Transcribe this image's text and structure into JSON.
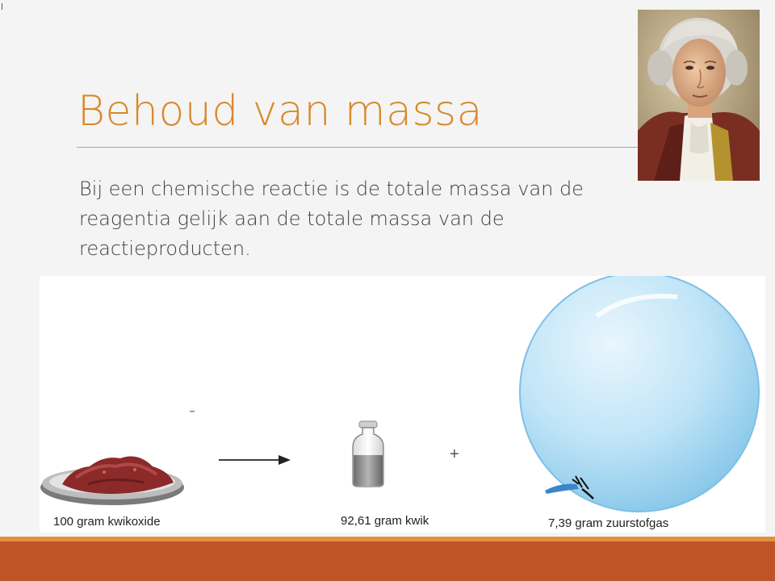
{
  "slide": {
    "title": "Behoud van massa",
    "body": "Bij een chemische reactie is de totale massa van de reagentia gelijk aan de totale massa van de reactieproducten."
  },
  "portrait": {
    "description_icon": "portrait-lavoisier"
  },
  "illustration": {
    "captions": {
      "reactant": "100 gram kwikoxide",
      "product_1": "92,61 gram kwik",
      "product_2": "7,39 gram zuurstofgas"
    },
    "plus_sign": "+",
    "icons": [
      "dish-icon",
      "arrow-icon",
      "bottle-icon",
      "balloon-icon"
    ]
  },
  "theme": {
    "title_color": "#d8892c",
    "text_color": "#404040",
    "accent_bar_top": "#e2923c",
    "accent_bar_bottom": "#bf5426",
    "background": "#f4f4f4"
  }
}
